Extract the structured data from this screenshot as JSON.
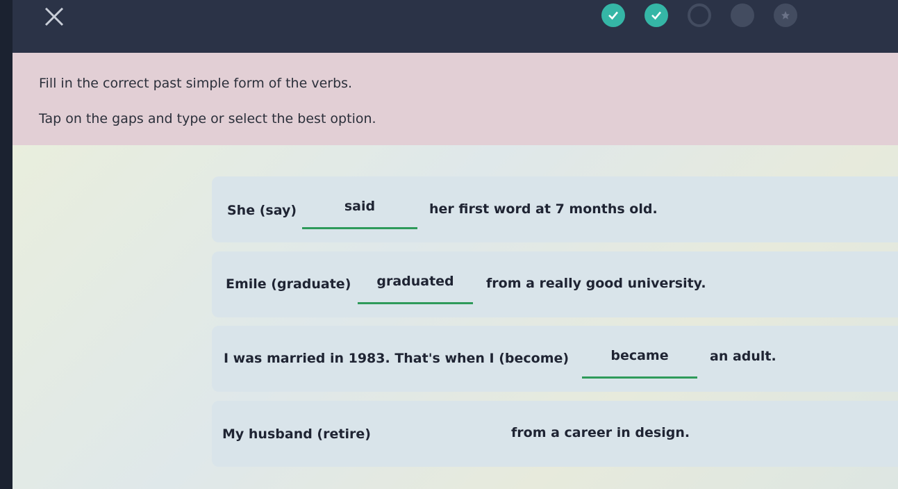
{
  "progress": {
    "steps": [
      {
        "state": "done",
        "icon": "check-icon"
      },
      {
        "state": "done",
        "icon": "check-icon"
      },
      {
        "state": "current",
        "icon": ""
      },
      {
        "state": "todo",
        "icon": ""
      },
      {
        "state": "todo",
        "icon": "star-icon"
      }
    ]
  },
  "instructions": {
    "line1": "Fill in the correct past simple form of the verbs.",
    "line2": "Tap on the gaps and type or select the best option."
  },
  "items": [
    {
      "before": "She (say)",
      "answer": "said",
      "after": "her first word at 7 months old."
    },
    {
      "before": "Emile (graduate)",
      "answer": "graduated",
      "after": "from a really good university."
    },
    {
      "before": "I was married in 1983. That's when I (become)",
      "answer": "became",
      "after": "an adult."
    },
    {
      "before": "My husband (retire)",
      "answer": "",
      "after": "from a career in design."
    }
  ],
  "colors": {
    "topbar": "#2b3347",
    "header": "#e2cfd5",
    "done": "#35b6a6",
    "underline": "#2e9a5a"
  }
}
